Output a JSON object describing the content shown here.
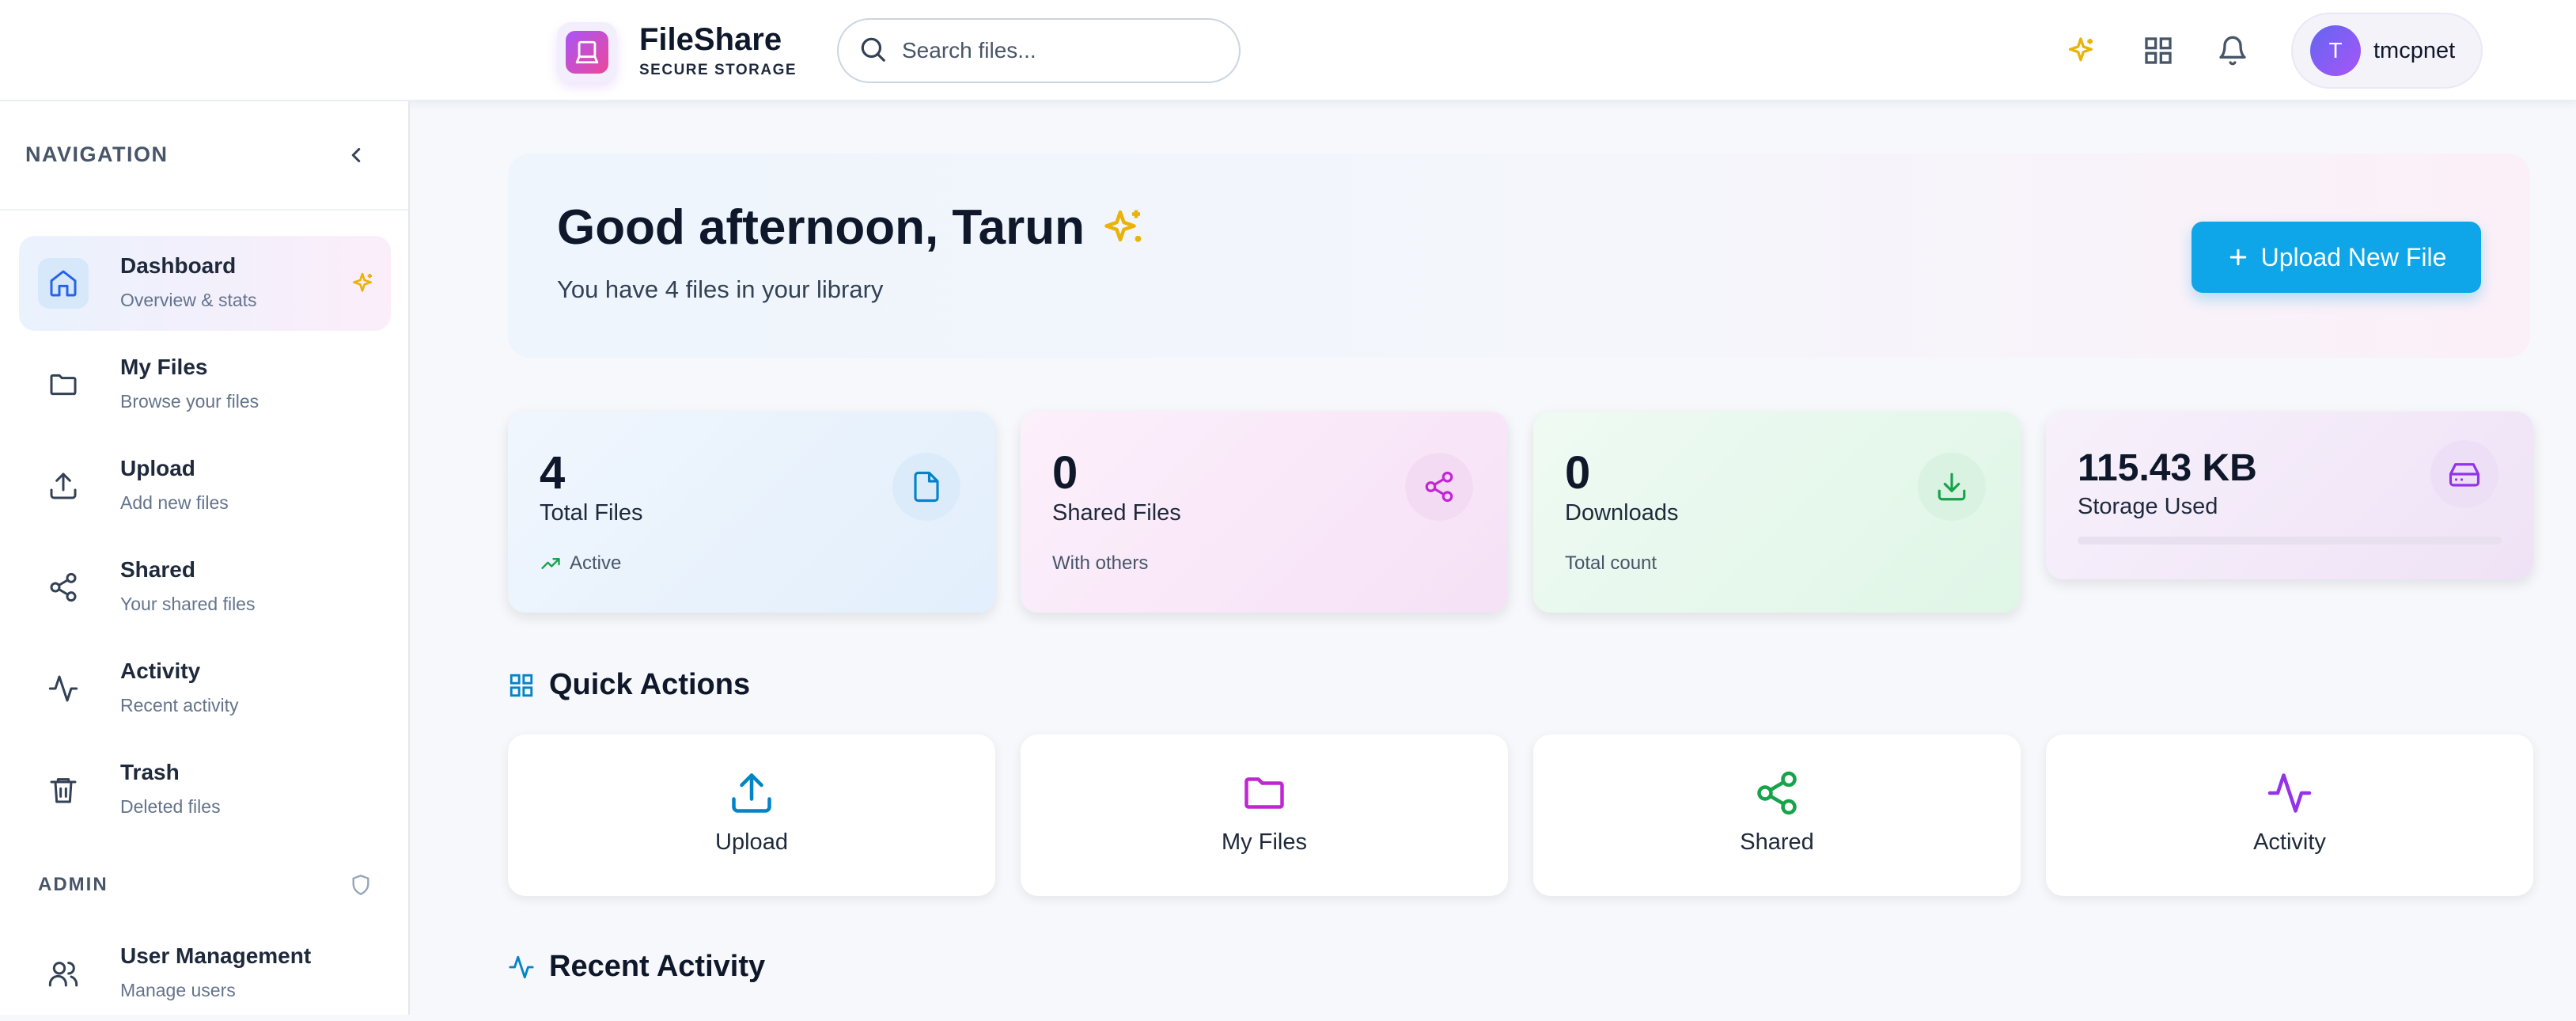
{
  "header": {
    "brand_name": "FileShare",
    "brand_sub": "SECURE STORAGE",
    "search_placeholder": "Search files...",
    "user_initial": "T",
    "user_name": "tmcpnet"
  },
  "sidebar": {
    "heading": "NAVIGATION",
    "items": [
      {
        "title": "Dashboard",
        "sub": "Overview & stats",
        "icon": "home-icon"
      },
      {
        "title": "My Files",
        "sub": "Browse your files",
        "icon": "folder-icon"
      },
      {
        "title": "Upload",
        "sub": "Add new files",
        "icon": "upload-icon"
      },
      {
        "title": "Shared",
        "sub": "Your shared files",
        "icon": "share-icon"
      },
      {
        "title": "Activity",
        "sub": "Recent activity",
        "icon": "activity-icon"
      },
      {
        "title": "Trash",
        "sub": "Deleted files",
        "icon": "trash-icon"
      }
    ],
    "admin_heading": "ADMIN",
    "admin_items": [
      {
        "title": "User Management",
        "sub": "Manage users",
        "icon": "users-icon"
      }
    ]
  },
  "welcome": {
    "greeting": "Good afternoon, Tarun",
    "subtitle": "You have 4 files in your library",
    "upload_button": "Upload New File"
  },
  "stats": [
    {
      "value": "4",
      "label": "Total Files",
      "foot": "Active",
      "icon": "file-icon",
      "color": "#0284c7"
    },
    {
      "value": "0",
      "label": "Shared Files",
      "foot": "With others",
      "icon": "share-icon",
      "color": "#c026d3"
    },
    {
      "value": "0",
      "label": "Downloads",
      "foot": "Total count",
      "icon": "download-icon",
      "color": "#16a34a"
    },
    {
      "value": "115.43 KB",
      "label": "Storage Used",
      "icon": "hard-drive-icon",
      "color": "#9333ea",
      "usage_fraction": 0.0
    }
  ],
  "quick_actions": {
    "title": "Quick Actions",
    "items": [
      {
        "label": "Upload",
        "icon": "upload-icon",
        "color": "#0284c7"
      },
      {
        "label": "My Files",
        "icon": "folder-icon",
        "color": "#c026d3"
      },
      {
        "label": "Shared",
        "icon": "share-icon",
        "color": "#16a34a"
      },
      {
        "label": "Activity",
        "icon": "activity-icon",
        "color": "#9333ea"
      }
    ]
  },
  "recent_activity": {
    "title": "Recent Activity"
  },
  "colors": {
    "accent": "#0ea5e9",
    "sparkle": "#eab308"
  }
}
